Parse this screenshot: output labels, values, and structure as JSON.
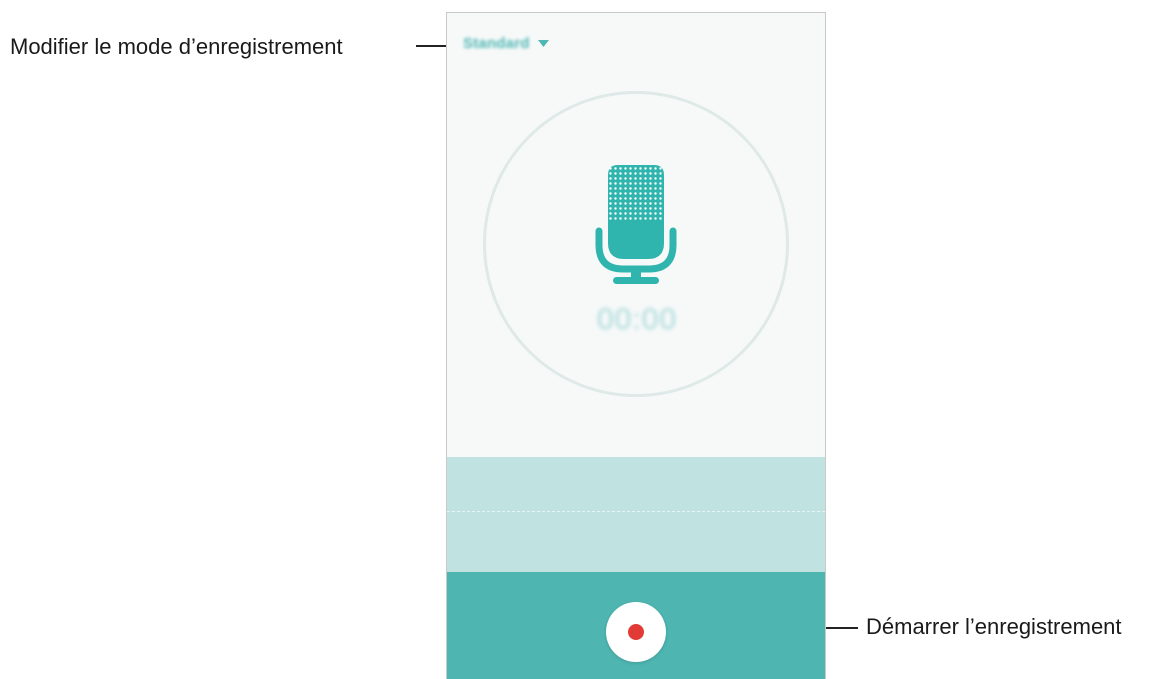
{
  "callouts": {
    "mode": "Modifier le mode d’enregistrement",
    "record": "Démarrer l’enregistrement"
  },
  "recorder": {
    "mode_label": "Standard",
    "timer": "00:00"
  },
  "icons": {
    "dropdown": "caret-down-icon",
    "microphone": "microphone-icon",
    "record": "record-icon"
  },
  "colors": {
    "accent": "#4eb5b1",
    "waveform_bg": "#c0e3e2",
    "record": "#e23b36"
  }
}
